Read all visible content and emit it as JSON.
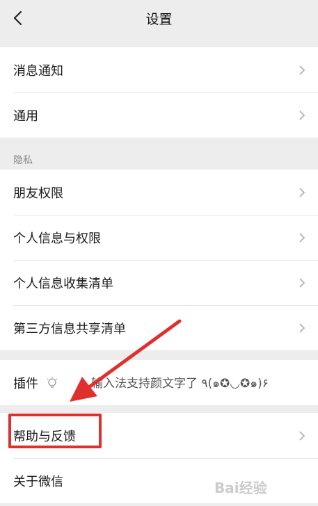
{
  "header": {
    "title": "设置",
    "back_icon": "chevron-left-icon"
  },
  "groups": [
    {
      "items": [
        {
          "label": "消息通知"
        },
        {
          "label": "通用"
        }
      ]
    },
    {
      "section_label": "隐私",
      "items": [
        {
          "label": "朋友权限"
        },
        {
          "label": "个人信息与权限"
        },
        {
          "label": "个人信息收集清单"
        },
        {
          "label": "第三方信息共享清单"
        }
      ]
    },
    {
      "items": [
        {
          "label": "插件",
          "note": "输入法支持颜文字了 ٩(๑✪◡✪๑)۶"
        }
      ]
    },
    {
      "items": [
        {
          "label": "帮助与反馈"
        },
        {
          "label": "关于微信"
        }
      ]
    }
  ],
  "annotation": {
    "highlight_color": "#e0302e"
  },
  "watermark": {
    "text": "Bai经验"
  }
}
